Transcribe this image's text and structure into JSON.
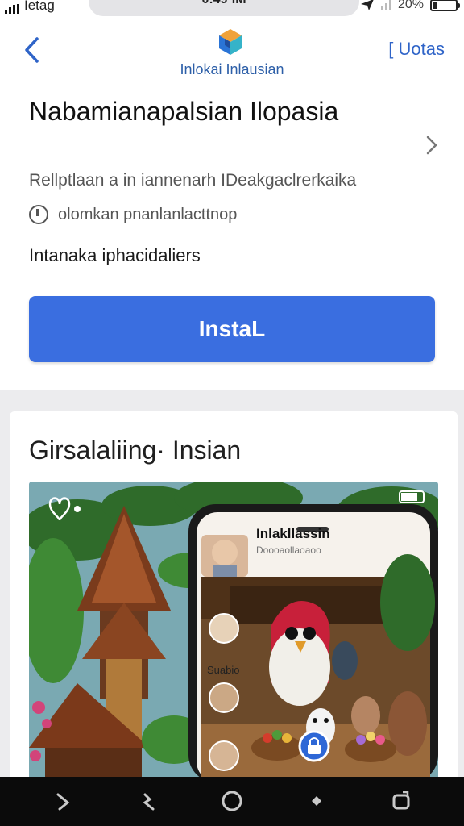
{
  "status_bar": {
    "carrier": "Ietag",
    "time": "0:49·IM",
    "battery": "20%"
  },
  "header": {
    "app_name": "Inlokai Inlausian",
    "action_label": "[ Uotas"
  },
  "app": {
    "title": "Nabamianapalsian Ilopasia",
    "description": "Rellptlaan a in iannenarh IDeakgaclrerkaika",
    "meta": "olomkan pnanlanlacttnop",
    "subtitle": "Intanaka iphacidaliers",
    "install_label": "InstaL"
  },
  "section": {
    "title": "Girsalaliing· Insian",
    "promo_phone_title": "Inlakllassin",
    "promo_phone_subtitle": "Doooaollaoaoo",
    "promo_side_label": "Suabio"
  },
  "colors": {
    "accent": "#3a6ee0",
    "link": "#2f64c8",
    "nav_bg": "#0b0b0b"
  },
  "icons": {
    "back": "chevron-left-icon",
    "forward": "chevron-right-icon",
    "meta": "clock-icon",
    "nav": [
      "nav-back-icon",
      "nav-return-icon",
      "home-circle-icon",
      "diamond-icon",
      "recents-icon"
    ]
  }
}
